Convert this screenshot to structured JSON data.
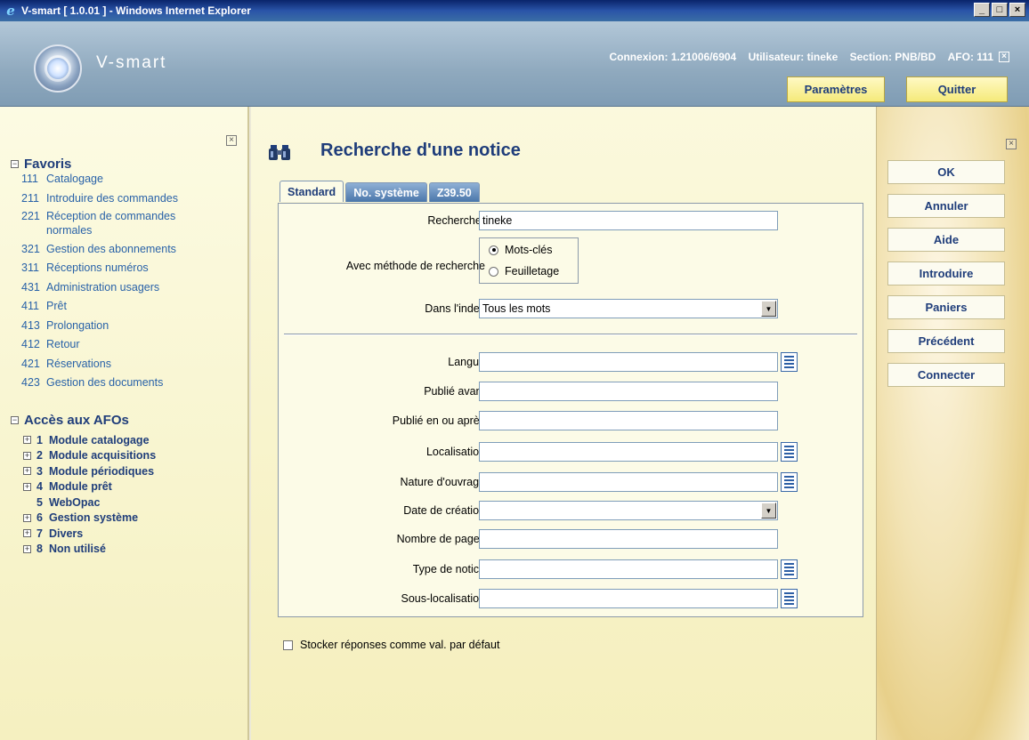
{
  "window": {
    "title": "V-smart [ 1.0.01 ] - Windows Internet Explorer",
    "controls": {
      "minimize": "_",
      "maximize": "□",
      "close": "×"
    }
  },
  "header": {
    "logo_text": "V-smart",
    "connexion": "Connexion: 1.21006/6904",
    "utilisateur": "Utilisateur: tineke",
    "section": "Section: PNB/BD",
    "afo": "AFO: 111",
    "close_glyph": "×",
    "parametres_label": "Paramètres",
    "quitter_label": "Quitter"
  },
  "sidebar": {
    "close_glyph": "×",
    "favoris": {
      "title": "Favoris",
      "toggle": "−",
      "items": [
        {
          "num": "111",
          "label": "Catalogage"
        },
        {
          "num": "211",
          "label": "Introduire des commandes"
        },
        {
          "num": "221",
          "label": "Réception de commandes normales"
        },
        {
          "num": "321",
          "label": "Gestion des abonnements"
        },
        {
          "num": "311",
          "label": "Réceptions numéros"
        },
        {
          "num": "431",
          "label": "Administration usagers"
        },
        {
          "num": "411",
          "label": "Prêt"
        },
        {
          "num": "413",
          "label": "Prolongation"
        },
        {
          "num": "412",
          "label": "Retour"
        },
        {
          "num": "421",
          "label": "Réservations"
        },
        {
          "num": "423",
          "label": "Gestion des documents"
        }
      ]
    },
    "acces": {
      "title": "Accès aux AFOs",
      "toggle": "−",
      "items": [
        {
          "num": "1",
          "label": "Module catalogage",
          "toggle": "+"
        },
        {
          "num": "2",
          "label": "Module acquisitions",
          "toggle": "+"
        },
        {
          "num": "3",
          "label": "Module périodiques",
          "toggle": "+"
        },
        {
          "num": "4",
          "label": "Module prêt",
          "toggle": "+"
        },
        {
          "num": "5",
          "label": "WebOpac",
          "toggle": ""
        },
        {
          "num": "6",
          "label": "Gestion système",
          "toggle": "+"
        },
        {
          "num": "7",
          "label": "Divers",
          "toggle": "+"
        },
        {
          "num": "8",
          "label": "Non utilisé",
          "toggle": "+"
        }
      ]
    }
  },
  "main": {
    "title": "Recherche d'une notice",
    "tabs": [
      {
        "label": "Standard",
        "active": true
      },
      {
        "label": "No. système",
        "active": false
      },
      {
        "label": "Z39.50",
        "active": false
      }
    ],
    "rechercher_label": "Rechercher",
    "rechercher_value": "tineke",
    "methode_label": "Avec méthode de recherche",
    "radio_motscles": "Mots-clés",
    "radio_feuilletage": "Feuilletage",
    "index_label": "Dans l'index",
    "index_value": "Tous les mots",
    "select_arrow": "▼",
    "langue_label": "Langue",
    "publie_avant_label": "Publié avant",
    "publie_apres_label": "Publié en ou après",
    "localisation_label": "Localisation",
    "nature_label": "Nature d'ouvrage",
    "date_creation_label": "Date de création",
    "nb_pages_label": "Nombre de pages",
    "type_notice_label": "Type de notice",
    "sous_localisation_label": "Sous-localisation",
    "stocker_label": "Stocker réponses comme val. par défaut"
  },
  "actions": {
    "close_glyph": "×",
    "ok": "OK",
    "annuler": "Annuler",
    "aide": "Aide",
    "introduire": "Introduire",
    "paniers": "Paniers",
    "precedent": "Précédent",
    "connecter": "Connecter"
  },
  "colors": {
    "title_blue": "#1f3d7a",
    "link_blue": "#2962a8",
    "header_yellow": "#f5ea7a",
    "panel_bg": "#fcfbe7"
  }
}
